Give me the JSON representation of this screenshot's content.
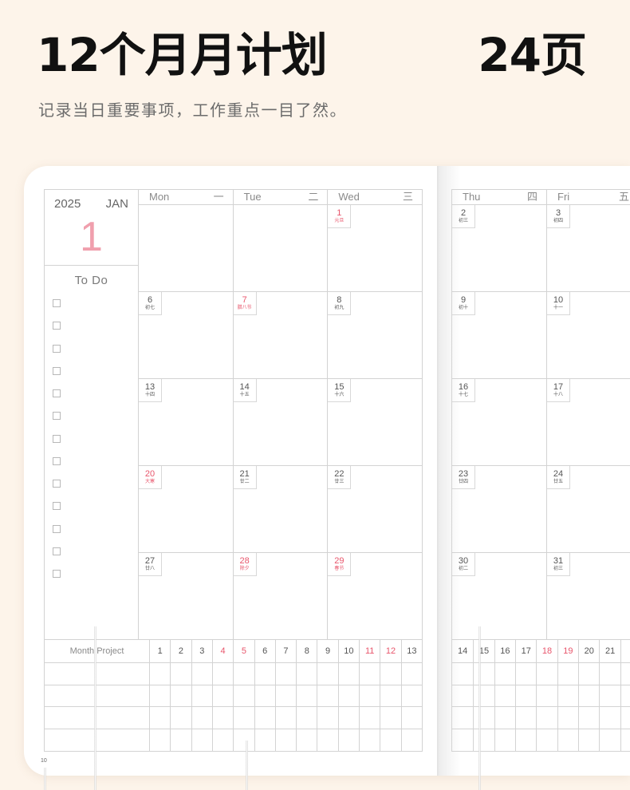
{
  "header": {
    "title": "12个月月计划",
    "page_count": "24页",
    "subtitle": "记录当日重要事项，工作重点一目了然。"
  },
  "planner": {
    "year": "2025",
    "month": "JAN",
    "month_number": "1",
    "todo": {
      "label": "To Do",
      "items": [
        {
          "checked": false
        },
        {
          "checked": false
        },
        {
          "checked": false
        },
        {
          "checked": false
        },
        {
          "checked": false
        },
        {
          "checked": false
        },
        {
          "checked": false
        },
        {
          "checked": false
        },
        {
          "checked": false
        },
        {
          "checked": false
        },
        {
          "checked": false
        },
        {
          "checked": false
        },
        {
          "checked": false
        }
      ]
    },
    "left_page": {
      "days": [
        {
          "en": "Mon",
          "cn": "一"
        },
        {
          "en": "Tue",
          "cn": "二"
        },
        {
          "en": "Wed",
          "cn": "三"
        }
      ],
      "weeks": [
        [
          null,
          null,
          {
            "date": "1",
            "lunar": "元旦",
            "highlight": true
          }
        ],
        [
          {
            "date": "6",
            "lunar": "初七"
          },
          {
            "date": "7",
            "lunar": "腊八节",
            "highlight": true
          },
          {
            "date": "8",
            "lunar": "初九"
          }
        ],
        [
          {
            "date": "13",
            "lunar": "十四"
          },
          {
            "date": "14",
            "lunar": "十五"
          },
          {
            "date": "15",
            "lunar": "十六"
          }
        ],
        [
          {
            "date": "20",
            "lunar": "大寒",
            "highlight": true
          },
          {
            "date": "21",
            "lunar": "廿二"
          },
          {
            "date": "22",
            "lunar": "廿三"
          }
        ],
        [
          {
            "date": "27",
            "lunar": "廿八"
          },
          {
            "date": "28",
            "lunar": "除夕",
            "highlight": true
          },
          {
            "date": "29",
            "lunar": "春节",
            "highlight": true
          }
        ]
      ],
      "month_project": {
        "label": "Month Project",
        "days": [
          {
            "d": "1"
          },
          {
            "d": "2"
          },
          {
            "d": "3"
          },
          {
            "d": "4",
            "highlight": true
          },
          {
            "d": "5",
            "highlight": true
          },
          {
            "d": "6"
          },
          {
            "d": "7"
          },
          {
            "d": "8"
          },
          {
            "d": "9"
          },
          {
            "d": "10"
          },
          {
            "d": "11",
            "highlight": true
          },
          {
            "d": "12",
            "highlight": true
          },
          {
            "d": "13"
          }
        ]
      },
      "page_number": "10"
    },
    "right_page": {
      "days": [
        {
          "en": "Thu",
          "cn": "四"
        },
        {
          "en": "Fri",
          "cn": "五"
        }
      ],
      "weeks": [
        [
          {
            "date": "2",
            "lunar": "初三"
          },
          {
            "date": "3",
            "lunar": "初四"
          }
        ],
        [
          {
            "date": "9",
            "lunar": "初十"
          },
          {
            "date": "10",
            "lunar": "十一"
          }
        ],
        [
          {
            "date": "16",
            "lunar": "十七"
          },
          {
            "date": "17",
            "lunar": "十八"
          }
        ],
        [
          {
            "date": "23",
            "lunar": "廿四"
          },
          {
            "date": "24",
            "lunar": "廿五"
          }
        ],
        [
          {
            "date": "30",
            "lunar": "初二"
          },
          {
            "date": "31",
            "lunar": "初三"
          }
        ]
      ],
      "month_project": {
        "days": [
          {
            "d": "14"
          },
          {
            "d": "15"
          },
          {
            "d": "16"
          },
          {
            "d": "17"
          },
          {
            "d": "18",
            "highlight": true
          },
          {
            "d": "19",
            "highlight": true
          },
          {
            "d": "20"
          },
          {
            "d": "21"
          }
        ]
      }
    }
  },
  "colors": {
    "background": "#fdf4ea",
    "highlight": "#e8566c",
    "month_number": "#f09fad",
    "grid_line": "#d3d3d3"
  }
}
